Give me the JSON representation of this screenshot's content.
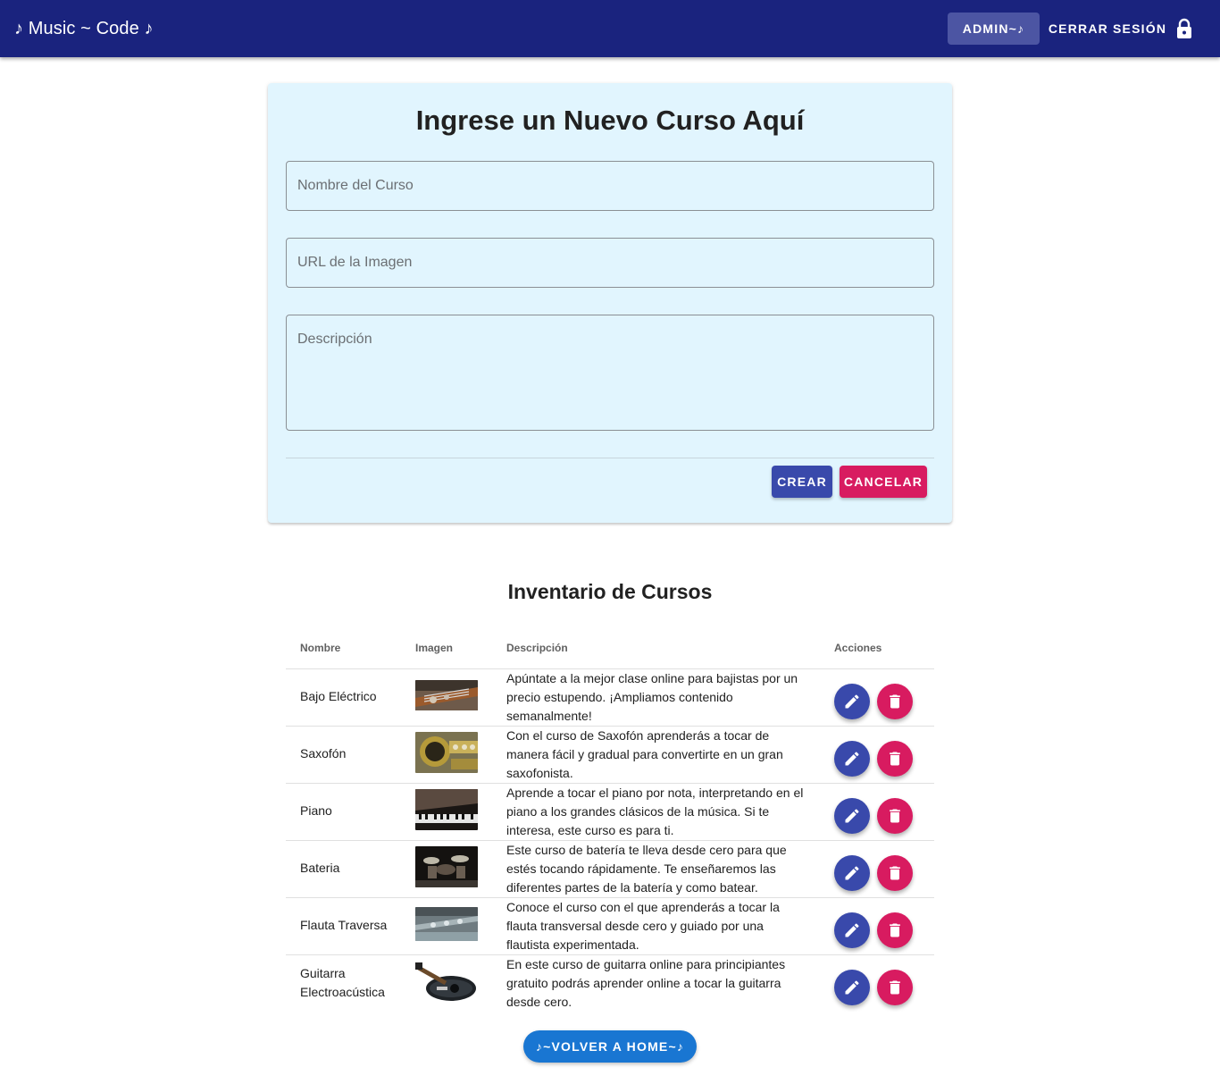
{
  "header": {
    "brand": "♪ Music ~ Code ♪",
    "admin_label": "ADMIN~♪",
    "logout_label": "CERRAR SESIÓN",
    "logout_icon": "lock-icon",
    "bar_color": "#1a237e"
  },
  "form": {
    "title": "Ingrese un Nuevo Curso Aquí",
    "name_placeholder": "Nombre del Curso",
    "image_placeholder": "URL de la Imagen",
    "description_placeholder": "Descripción",
    "create_label": "CREAR",
    "cancel_label": "CANCELAR",
    "card_color": "#e1f5fe"
  },
  "inventory": {
    "title": "Inventario de Cursos",
    "columns": [
      "Nombre",
      "Imagen",
      "Descripción",
      "Acciones"
    ],
    "rows": [
      {
        "name": "Bajo Eléctrico",
        "description": "Apúntate a la mejor clase online para bajistas por un precio estupendo. ¡Ampliamos contenido semanalmente!",
        "image": "bass-guitar-photo"
      },
      {
        "name": "Saxofón",
        "description": "Con el curso de Saxofón aprenderás a tocar de manera fácil y gradual para convertirte en un gran saxofonista.",
        "image": "saxophone-photo"
      },
      {
        "name": "Piano",
        "description": "Aprende a tocar el piano por nota, interpretando en el piano a los grandes clásicos de la música. Si te interesa, este curso es para ti.",
        "image": "piano-photo"
      },
      {
        "name": "Bateria",
        "description": "Este curso de batería te lleva desde cero para que estés tocando rápidamente. Te enseñaremos las diferentes partes de la batería y como batear.",
        "image": "drums-photo"
      },
      {
        "name": "Flauta Traversa",
        "description": "Conoce el curso con el que aprenderás a tocar la flauta transversal desde cero y guiado por una flautista experimentada.",
        "image": "flute-photo"
      },
      {
        "name": "Guitarra Electroacústica",
        "description": "En este curso de guitarra online para principiantes gratuito podrás aprender online a tocar la guitarra desde cero.",
        "image": "acoustic-guitar-photo"
      }
    ],
    "edit_icon": "pencil-icon",
    "delete_icon": "trash-icon",
    "edit_color": "#3949ab",
    "delete_color": "#d81b60"
  },
  "footer": {
    "home_label": "♪~VOLVER A HOME~♪"
  }
}
